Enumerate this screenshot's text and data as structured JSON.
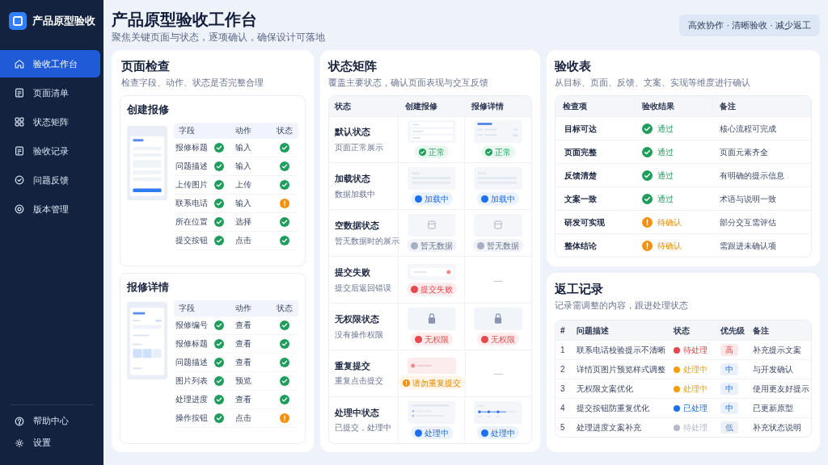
{
  "sidebar": {
    "brand": "产品原型验收",
    "items": [
      {
        "label": "验收工作台",
        "selected": true
      },
      {
        "label": "页面清单",
        "selected": false
      },
      {
        "label": "状态矩阵",
        "selected": false
      },
      {
        "label": "验收记录",
        "selected": false
      },
      {
        "label": "问题反馈",
        "selected": false
      },
      {
        "label": "版本管理",
        "selected": false
      }
    ],
    "footer_items": [
      "帮助中心",
      "设置"
    ]
  },
  "header": {
    "title": "产品原型验收工作台",
    "subtitle": "聚焦关键页面与状态，逐项确认，确保设计可落地",
    "tagline": "高效协作 · 清晰验收 · 减少返工"
  },
  "page_check": {
    "title": "页面检查",
    "subtitle": "检查字段、动作、状态是否完整合理",
    "sections": [
      {
        "title": "创建报修",
        "columns": [
          "字段",
          "动作",
          "状态"
        ],
        "rows": [
          {
            "field": "报修标题",
            "field_ok": true,
            "action": "输入",
            "status_ok": true
          },
          {
            "field": "问题描述",
            "field_ok": true,
            "action": "输入",
            "status_ok": true
          },
          {
            "field": "上传图片",
            "field_ok": true,
            "action": "上传",
            "status_ok": true
          },
          {
            "field": "联系电话",
            "field_ok": true,
            "action": "输入",
            "status_ok": false
          },
          {
            "field": "所在位置",
            "field_ok": true,
            "action": "选择",
            "status_ok": true
          },
          {
            "field": "提交按钮",
            "field_ok": true,
            "action": "点击",
            "status_ok": true
          }
        ]
      },
      {
        "title": "报修详情",
        "columns": [
          "字段",
          "动作",
          "状态"
        ],
        "rows": [
          {
            "field": "报修编号",
            "field_ok": true,
            "action": "查看",
            "status_ok": true
          },
          {
            "field": "报修标题",
            "field_ok": true,
            "action": "查看",
            "status_ok": true
          },
          {
            "field": "问题描述",
            "field_ok": true,
            "action": "查看",
            "status_ok": true
          },
          {
            "field": "图片列表",
            "field_ok": true,
            "action": "预览",
            "status_ok": true
          },
          {
            "field": "处理进度",
            "field_ok": true,
            "action": "查看",
            "status_ok": true
          },
          {
            "field": "操作按钮",
            "field_ok": true,
            "action": "点击",
            "status_ok": false
          }
        ]
      }
    ]
  },
  "matrix": {
    "title": "状态矩阵",
    "subtitle": "覆盖主要状态，确认页面表现与交互反馈",
    "columns": [
      "状态",
      "创建报修",
      "报修详情"
    ],
    "rows": [
      {
        "state": {
          "name": "默认状态",
          "desc": "页面正常展示"
        },
        "cells": [
          {
            "kind": "form",
            "badge": {
              "label": "正常",
              "kind": "success"
            }
          },
          {
            "kind": "detail",
            "badge": {
              "label": "正常",
              "kind": "success"
            }
          }
        ]
      },
      {
        "state": {
          "name": "加载状态",
          "desc": "数据加载中"
        },
        "cells": [
          {
            "kind": "loading",
            "badge": {
              "label": "加载中",
              "kind": "info"
            }
          },
          {
            "kind": "loading",
            "badge": {
              "label": "加载中",
              "kind": "info"
            }
          }
        ]
      },
      {
        "state": {
          "name": "空数据状态",
          "desc": "暂无数据时的展示"
        },
        "cells": [
          {
            "kind": "empty",
            "badge": {
              "label": "暂无数据",
              "kind": "muted"
            }
          },
          {
            "kind": "empty",
            "badge": {
              "label": "暂无数据",
              "kind": "muted"
            }
          }
        ]
      },
      {
        "state": {
          "name": "提交失败",
          "desc": "提交后返回错误"
        },
        "cells": [
          {
            "kind": "error",
            "badge": {
              "label": "提交失败",
              "kind": "danger"
            }
          },
          {
            "kind": "none",
            "text": "—"
          }
        ]
      },
      {
        "state": {
          "name": "无权限状态",
          "desc": "没有操作权限"
        },
        "cells": [
          {
            "kind": "locked",
            "badge": {
              "label": "无权限",
              "kind": "danger"
            }
          },
          {
            "kind": "locked",
            "badge": {
              "label": "无权限",
              "kind": "danger"
            }
          }
        ]
      },
      {
        "state": {
          "name": "重复提交",
          "desc": "重复点击提交"
        },
        "cells": [
          {
            "kind": "duplicate",
            "badge": {
              "label": "请勿重复提交",
              "kind": "warn"
            }
          },
          {
            "kind": "none",
            "text": "—"
          }
        ]
      },
      {
        "state": {
          "name": "处理中状态",
          "desc": "已提交，处理中"
        },
        "cells": [
          {
            "kind": "progress",
            "badge": {
              "label": "处理中",
              "kind": "info"
            }
          },
          {
            "kind": "steps",
            "badge": {
              "label": "处理中",
              "kind": "info"
            }
          }
        ]
      }
    ]
  },
  "acceptance": {
    "title": "验收表",
    "subtitle": "从目标、页面、反馈、文案、实现等维度进行确认",
    "columns": [
      "检查项",
      "验收结果",
      "备注"
    ],
    "rows": [
      {
        "item": "目标可达",
        "result": {
          "label": "通过",
          "passed": true
        },
        "note": "核心流程可完成"
      },
      {
        "item": "页面完整",
        "result": {
          "label": "通过",
          "passed": true
        },
        "note": "页面元素齐全"
      },
      {
        "item": "反馈清楚",
        "result": {
          "label": "通过",
          "passed": true
        },
        "note": "有明确的提示信息"
      },
      {
        "item": "文案一致",
        "result": {
          "label": "通过",
          "passed": true
        },
        "note": "术语与说明一致"
      },
      {
        "item": "研发可实现",
        "result": {
          "label": "待确认",
          "passed": false
        },
        "note": "部分交互需评估"
      },
      {
        "item": "整体结论",
        "result": {
          "label": "待确认",
          "passed": false
        },
        "note": "需跟进未确认项"
      }
    ]
  },
  "rework": {
    "title": "返工记录",
    "subtitle": "记录需调整的内容，跟进处理状态",
    "columns": [
      "#",
      "问题描述",
      "状态",
      "优先级",
      "备注"
    ],
    "rows": [
      {
        "no": "1",
        "desc": "联系电话校验提示不清晰",
        "status": {
          "label": "待处理",
          "color": "#e5484d"
        },
        "priority": {
          "label": "高",
          "kind": "high"
        },
        "note": "补充提示文案"
      },
      {
        "no": "2",
        "desc": "详情页图片预览样式调整",
        "status": {
          "label": "处理中",
          "color": "#f59e0b"
        },
        "priority": {
          "label": "中",
          "kind": "medium"
        },
        "note": "与开发确认"
      },
      {
        "no": "3",
        "desc": "无权限文案优化",
        "status": {
          "label": "处理中",
          "color": "#f59e0b"
        },
        "priority": {
          "label": "中",
          "kind": "medium"
        },
        "note": "使用更友好提示"
      },
      {
        "no": "4",
        "desc": "提交按钮防重复优化",
        "status": {
          "label": "已处理",
          "color": "#1d6ff2"
        },
        "priority": {
          "label": "中",
          "kind": "medium"
        },
        "note": "已更新原型"
      },
      {
        "no": "5",
        "desc": "处理进度文案补充",
        "status": {
          "label": "待处理",
          "color": "#b4b9cc"
        },
        "priority": {
          "label": "低",
          "kind": "low"
        },
        "note": "补充状态说明"
      }
    ]
  }
}
